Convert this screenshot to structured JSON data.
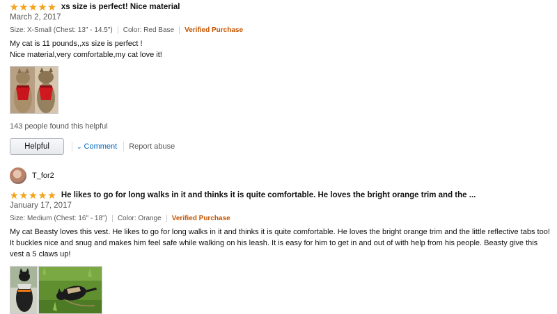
{
  "reviews": [
    {
      "rating": 5,
      "title": "xs size is perfect! Nice material",
      "date": "March 2, 2017",
      "size": "Size: X-Small (Chest: 13\" - 14.5\")",
      "color": "Color: Red Base",
      "verified": "Verified Purchase",
      "body": [
        "My cat is 11 pounds,,xs size is perfect !",
        "Nice material,very comfortable,my cat love it!"
      ],
      "images": [
        "cat-red-harness-photo-1",
        "cat-red-harness-photo-2"
      ],
      "helpful_count": "143 people found this helpful",
      "helpful_label": "Helpful",
      "comment_label": "Comment",
      "report_label": "Report abuse"
    },
    {
      "author": "T_for2",
      "rating": 5,
      "title": "He likes to go for long walks in it and thinks it is quite comfortable. He loves the bright orange trim and the ...",
      "date": "January 17, 2017",
      "size": "Size: Medium (Chest: 16\" - 18\")",
      "color": "Color: Orange",
      "verified": "Verified Purchase",
      "body": [
        "My cat Beasty loves this vest. He likes to go for long walks in it and thinks it is quite comfortable. He loves the bright orange trim and the little reflective tabs too! It buckles nice and snug and makes him feel safe while walking on his leash. It is easy for him to get in and out of with help from his people. Beasty give this vest a 5 claws up!"
      ],
      "images": [
        "black-cat-vest-photo-1",
        "black-cat-grass-photo-2"
      ]
    }
  ],
  "colors": {
    "star": "#f4a41c",
    "verified": "#c45500",
    "link": "#0066c0"
  },
  "icons": {
    "star": "star-icon",
    "chevron": "chevron-down-icon"
  }
}
